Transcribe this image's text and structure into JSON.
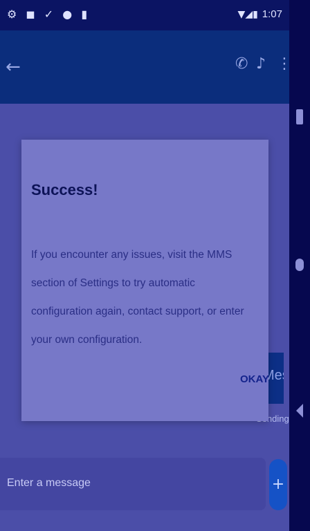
{
  "status_bar": {
    "left_icons": "⚙ ◼ ✓ ● ▮",
    "signal_icons": "▼◢▮",
    "time": "1:07"
  },
  "app_bar": {
    "back_icon": "←",
    "call_icon": "✆",
    "bell_icon": "♪",
    "more_icon": "⋮"
  },
  "conversation": {
    "bubble_text": "Message",
    "status_text": "Sending..."
  },
  "composer": {
    "placeholder": "Enter a message",
    "send_icon": "+"
  },
  "dialog": {
    "title": "Success!",
    "body": "If you encounter any issues, visit the MMS section of Settings to try automatic configuration again, contact support, or enter your own configuration.",
    "okay_label": "OKAY"
  },
  "colors": {
    "accent": "#1552c6",
    "app_bar": "#0b2d7c",
    "status_bar": "#0b1463"
  }
}
